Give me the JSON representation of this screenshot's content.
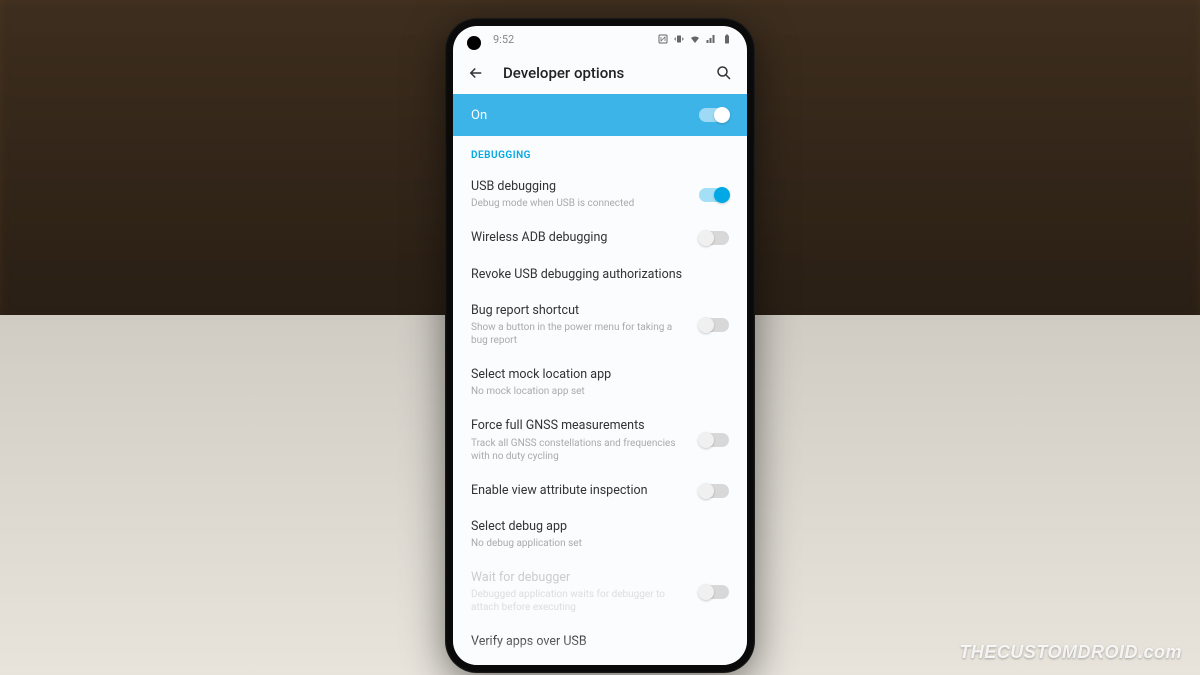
{
  "watermark": "THECUSTOMDROID.com",
  "status": {
    "time": "9:52"
  },
  "header": {
    "title": "Developer options"
  },
  "mainToggle": {
    "label": "On",
    "state": "on"
  },
  "section": {
    "label": "DEBUGGING"
  },
  "rows": {
    "usbDebugging": {
      "title": "USB debugging",
      "sub": "Debug mode when USB is connected",
      "toggle": "on"
    },
    "wirelessAdb": {
      "title": "Wireless ADB debugging",
      "toggle": "off"
    },
    "revoke": {
      "title": "Revoke USB debugging authorizations"
    },
    "bugReport": {
      "title": "Bug report shortcut",
      "sub": "Show a button in the power menu for taking a bug report",
      "toggle": "off"
    },
    "mockLocation": {
      "title": "Select mock location app",
      "sub": "No mock location app set"
    },
    "gnss": {
      "title": "Force full GNSS measurements",
      "sub": "Track all GNSS constellations and frequencies with no duty cycling",
      "toggle": "off"
    },
    "viewAttr": {
      "title": "Enable view attribute inspection",
      "toggle": "off"
    },
    "debugApp": {
      "title": "Select debug app",
      "sub": "No debug application set"
    },
    "waitDebugger": {
      "title": "Wait for debugger",
      "sub": "Debugged application waits for debugger to attach before executing",
      "toggle": "off"
    },
    "verifyUsb": {
      "title": "Verify apps over USB"
    }
  }
}
